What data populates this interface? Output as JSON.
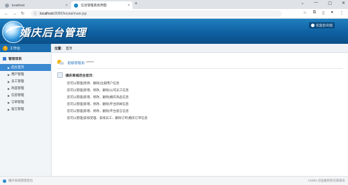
{
  "browser": {
    "tabs": [
      {
        "title": "localhost"
      },
      {
        "title": "信息管理系统界面"
      }
    ],
    "close_glyph": "×",
    "new_tab_glyph": "+",
    "url_host": "localhost",
    "url_path": ":8080/houtai/main.jsp"
  },
  "header": {
    "system_title": "婚庆后台管理",
    "user_button_label": "欢迎您!刘思"
  },
  "sidebar": {
    "workspace_label": "工作台",
    "section_label": "管理项目",
    "items": [
      {
        "label": "后台首页",
        "active": true
      },
      {
        "label": "用户管理",
        "active": false
      },
      {
        "label": "员工管理",
        "active": false
      },
      {
        "label": "商品管理",
        "active": false
      },
      {
        "label": "信息管理",
        "active": false
      },
      {
        "label": "订单管理",
        "active": false
      },
      {
        "label": "留言管理",
        "active": false
      }
    ]
  },
  "breadcrumb": {
    "label": "位置:",
    "value": "首页"
  },
  "main": {
    "welcome_text": "超级管理员:",
    "welcome_stars": "******",
    "info_title": "婚庆商城后台首页:",
    "lines": [
      "您可以管理(修改、删除)注册用户信息",
      "您可以管理(新增、修改、删除)公司员工信息",
      "您可以管理(新增、修改、删除)婚庆商品信息",
      "您可以管理(新增、修改、删除)平台新闻信息",
      "您可以管理(新增、修改、删除)平台留言信息",
      "您可以管理(安排受理、安排员工、删除订单)婚庆订单信息"
    ]
  },
  "footer": {
    "left_text": "婚庆商城管理后台",
    "right_text": "CSDN @运维的杂记家家乐"
  },
  "colors": {
    "header_blue": "#0e5e9e",
    "active_item": "#3b89d0",
    "link_blue": "#1c6fbf"
  }
}
